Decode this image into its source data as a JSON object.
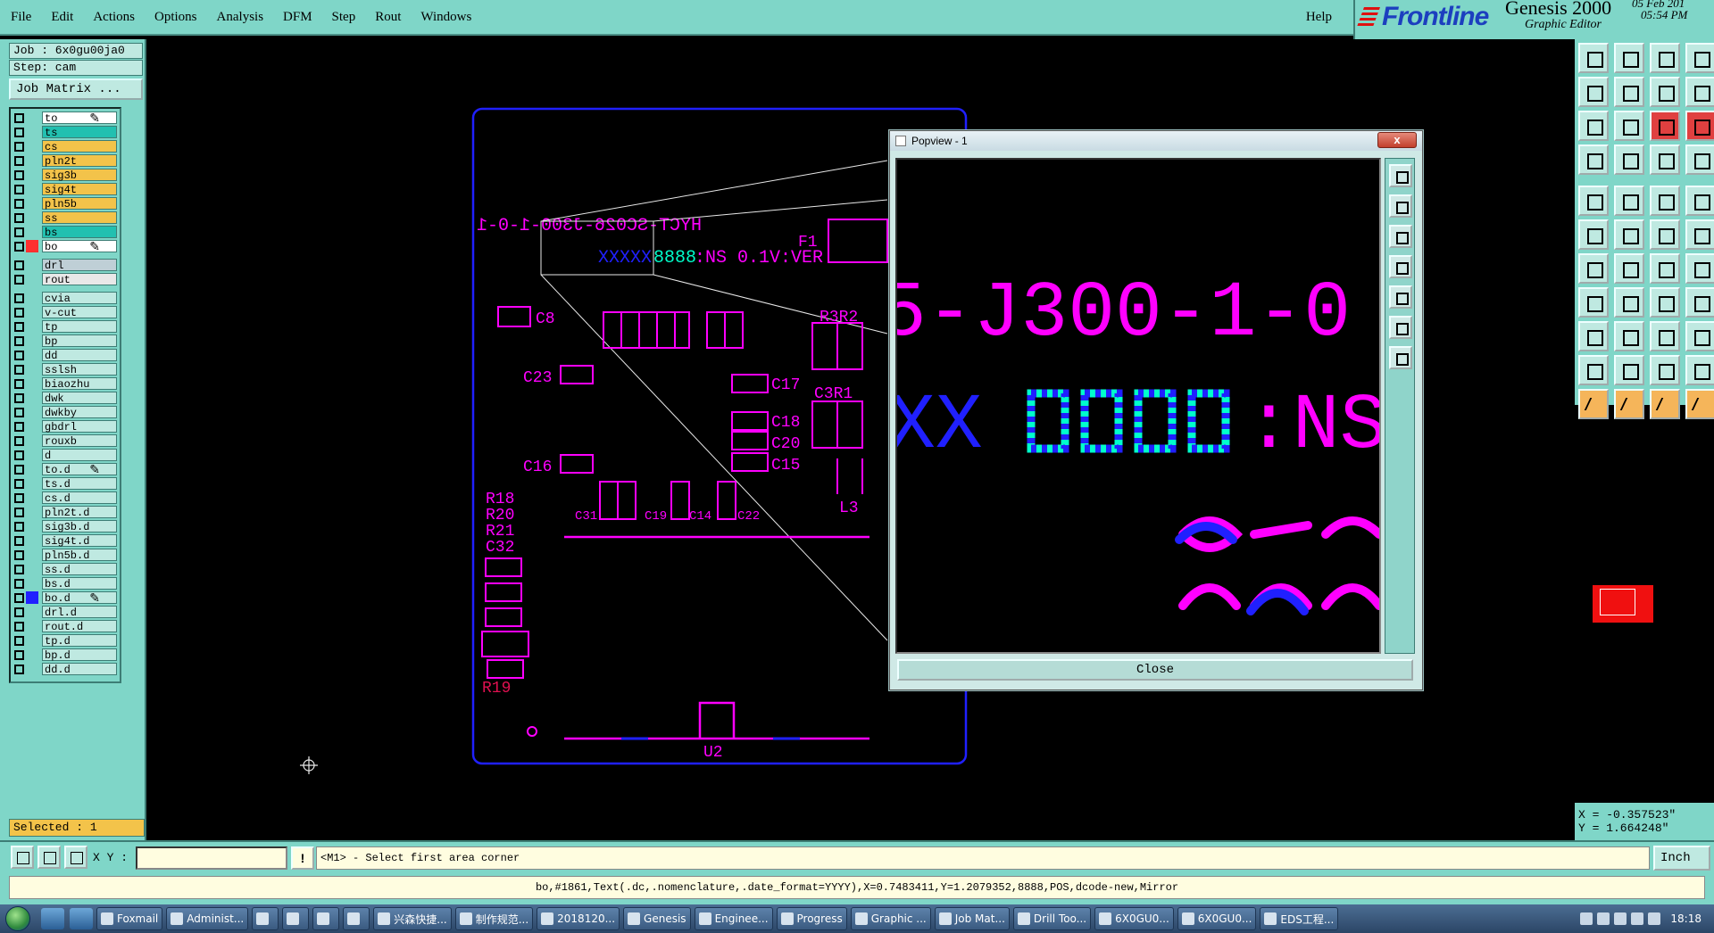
{
  "menubar": {
    "items": [
      "File",
      "Edit",
      "Actions",
      "Options",
      "Analysis",
      "DFM",
      "Step",
      "Rout",
      "Windows"
    ],
    "help": "Help"
  },
  "logo": {
    "brand": "Frontline",
    "product": "Genesis 2000",
    "subtitle": "Graphic Editor",
    "date": "05 Feb 201",
    "time": "05:54 PM"
  },
  "left_panel": {
    "job": "Job : 6x0gu00ja0",
    "step": "Step: cam",
    "job_matrix_button": "Job Matrix ...",
    "selected": "Selected : 1",
    "layers": [
      {
        "name": "to",
        "color": "#ffffff",
        "flag": "pencil-icon"
      },
      {
        "name": "ts",
        "color": "#22c0b0"
      },
      {
        "name": "cs",
        "color": "#f3c34a"
      },
      {
        "name": "pln2t",
        "color": "#f3c34a"
      },
      {
        "name": "sig3b",
        "color": "#f3c34a"
      },
      {
        "name": "sig4t",
        "color": "#f3c34a"
      },
      {
        "name": "pln5b",
        "color": "#f3c34a"
      },
      {
        "name": "ss",
        "color": "#f3c34a"
      },
      {
        "name": "bs",
        "color": "#22c0b0"
      },
      {
        "name": "bo",
        "color": "#ffffff",
        "flag": "pencil-icon",
        "active": true
      },
      {
        "name": "drl",
        "color": "#bfcfd6",
        "gap": true
      },
      {
        "name": "rout",
        "color": "#e8e8e8"
      },
      {
        "name": "cvia",
        "color": "#bfe9e1",
        "gap": true
      },
      {
        "name": "v-cut",
        "color": "#bfe9e1"
      },
      {
        "name": "tp",
        "color": "#bfe9e1"
      },
      {
        "name": "bp",
        "color": "#bfe9e1"
      },
      {
        "name": "dd",
        "color": "#bfe9e1"
      },
      {
        "name": "sslsh",
        "color": "#bfe9e1"
      },
      {
        "name": "biaozhu",
        "color": "#bfe9e1"
      },
      {
        "name": "dwk",
        "color": "#bfe9e1"
      },
      {
        "name": "dwkby",
        "color": "#bfe9e1"
      },
      {
        "name": "gbdrl",
        "color": "#bfe9e1"
      },
      {
        "name": "rouxb",
        "color": "#bfe9e1"
      },
      {
        "name": "d",
        "color": "#bfe9e1"
      },
      {
        "name": "to.d",
        "color": "#bfe9e1",
        "flag": "pencil-icon"
      },
      {
        "name": "ts.d",
        "color": "#bfe9e1"
      },
      {
        "name": "cs.d",
        "color": "#bfe9e1"
      },
      {
        "name": "pln2t.d",
        "color": "#bfe9e1"
      },
      {
        "name": "sig3b.d",
        "color": "#bfe9e1"
      },
      {
        "name": "sig4t.d",
        "color": "#bfe9e1"
      },
      {
        "name": "pln5b.d",
        "color": "#bfe9e1"
      },
      {
        "name": "ss.d",
        "color": "#bfe9e1"
      },
      {
        "name": "bs.d",
        "color": "#bfe9e1"
      },
      {
        "name": "bo.d",
        "color": "#bfe9e1",
        "flag": "pencil-icon",
        "blue": true
      },
      {
        "name": "drl.d",
        "color": "#bfe9e1"
      },
      {
        "name": "rout.d",
        "color": "#bfe9e1"
      },
      {
        "name": "tp.d",
        "color": "#bfe9e1"
      },
      {
        "name": "bp.d",
        "color": "#bfe9e1"
      },
      {
        "name": "dd.d",
        "color": "#bfe9e1"
      }
    ]
  },
  "board": {
    "part_number": "HYCT-SC026-J300-1-0-1",
    "rev_sn": "REV:V1.0 SN:8888XXXXX",
    "labels": [
      "F1",
      "C8",
      "R3R2",
      "C23",
      "C17",
      "C3R1",
      "C18",
      "C20",
      "C15",
      "C16",
      "L3",
      "R18",
      "R20",
      "R21",
      "C32",
      "C31",
      "C19",
      "C14",
      "C22",
      "R19",
      "U2"
    ],
    "colors": {
      "outline": "#2020ff",
      "silk": "#ff00ff",
      "text": "#ff00ff",
      "highlight": "#00ffcc"
    }
  },
  "popview": {
    "title": "Popview - 1",
    "close_x": "x",
    "close_button": "Close",
    "zoom_text_line1": "5-J300-1-0",
    "zoom_text_line2": "XX8888 :NS"
  },
  "right_panel": {
    "x": "X = -0.357523\"",
    "y": "Y =  1.664248\""
  },
  "command_row": {
    "xy_label": "X Y :",
    "xy_value": "",
    "info_button": "!",
    "prompt": "<M1> - Select first area corner",
    "unit": "Inch"
  },
  "status": {
    "info": "bo,#1861,Text(.dc,.nomenclature,.date_format=YYYY),X=0.7483411,Y=1.2079352,8888,POS,dcode-new,Mirror"
  },
  "taskbar": {
    "tasks": [
      "Foxmail",
      "Administ...",
      "",
      "",
      "",
      "",
      "兴森快捷...",
      "制作规范...",
      "2018120...",
      "Genesis",
      "Enginee...",
      "Progress",
      "Graphic ...",
      "Job Mat...",
      "Drill Too...",
      "6X0GU0...",
      "6X0GU0...",
      "EDS工程..."
    ],
    "clock": "18:18"
  }
}
